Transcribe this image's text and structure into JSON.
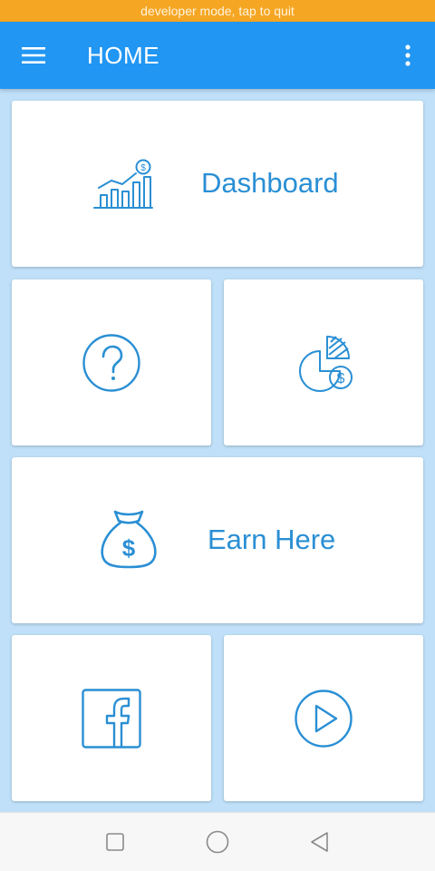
{
  "status": {
    "developer_mode_text": "developer mode, tap to quit",
    "color": "#f5a623"
  },
  "app_bar": {
    "title": "HOME",
    "color": "#2196f3",
    "menu_icon": "hamburger-menu-icon",
    "overflow_icon": "more-vertical-icon"
  },
  "tiles": [
    {
      "label": "Dashboard",
      "icon": "bar-chart-dollar-icon"
    },
    {
      "label": "",
      "icon": "help-question-icon"
    },
    {
      "label": "",
      "icon": "pie-chart-dollar-icon"
    },
    {
      "label": "Earn Here",
      "icon": "money-bag-icon"
    },
    {
      "label": "",
      "icon": "facebook-icon"
    },
    {
      "label": "",
      "icon": "play-icon"
    }
  ],
  "nav": {
    "recent_icon": "square-recent-icon",
    "home_icon": "circle-home-icon",
    "back_icon": "triangle-back-icon"
  },
  "colors": {
    "accent": "#2a8fd4",
    "background": "#bfe0f8"
  }
}
